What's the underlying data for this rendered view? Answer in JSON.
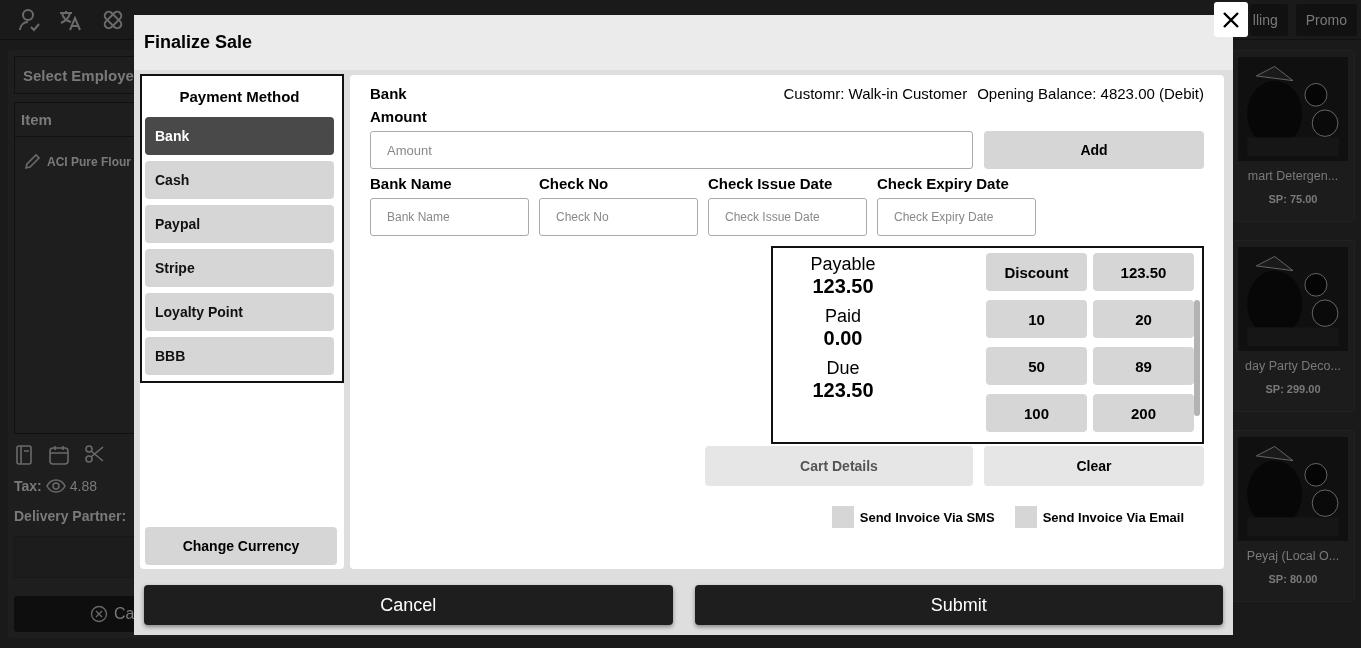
{
  "background": {
    "top_buttons": [
      "lling",
      "Promo"
    ],
    "employee_select": {
      "placeholder": "Select Employe"
    },
    "item_header": "Item",
    "cart_items": [
      "ACI Pure Flour"
    ],
    "tax_label": "Tax:",
    "tax_value": "4.88",
    "delivery_label": "Delivery Partner:",
    "cancel_button": "Ca",
    "products": [
      {
        "name": "mart Detergen...",
        "price": "SP: 75.00"
      },
      {
        "name": "day Party Deco...",
        "price": "SP: 299.00"
      },
      {
        "name": "Peyaj (Local O...",
        "price": "SP: 80.00"
      }
    ]
  },
  "dialog": {
    "title": "Finalize Sale",
    "payment_method_heading": "Payment Method",
    "payment_methods": [
      {
        "label": "Bank",
        "selected": true
      },
      {
        "label": "Cash",
        "selected": false
      },
      {
        "label": "Paypal",
        "selected": false
      },
      {
        "label": "Stripe",
        "selected": false
      },
      {
        "label": "Loyalty Point",
        "selected": false
      },
      {
        "label": "BBB",
        "selected": false
      }
    ],
    "change_currency": "Change Currency",
    "method_title": "Bank",
    "customer": "Customr: Walk-in Customer",
    "opening_balance": "Opening Balance: 4823.00 (Debit)",
    "amount": {
      "label": "Amount",
      "placeholder": "Amount"
    },
    "add_button": "Add",
    "fields": [
      {
        "label": "Bank Name",
        "placeholder": "Bank Name"
      },
      {
        "label": "Check No",
        "placeholder": "Check No"
      },
      {
        "label": "Check Issue Date",
        "placeholder": "Check Issue Date"
      },
      {
        "label": "Check Expiry Date",
        "placeholder": "Check Expiry Date"
      }
    ],
    "summary": [
      {
        "label": "Payable",
        "value": "123.50"
      },
      {
        "label": "Paid",
        "value": "0.00"
      },
      {
        "label": "Due",
        "value": "123.50"
      }
    ],
    "quick_buttons": [
      "Discount",
      "123.50",
      "10",
      "20",
      "50",
      "89",
      "100",
      "200"
    ],
    "cart_details": {
      "label": "Cart Details",
      "disabled": true
    },
    "clear_button": "Clear",
    "options": [
      {
        "label": "Send Invoice Via SMS",
        "checked": false
      },
      {
        "label": "Send Invoice Via Email",
        "checked": false
      }
    ],
    "cancel": "Cancel",
    "submit": "Submit"
  }
}
